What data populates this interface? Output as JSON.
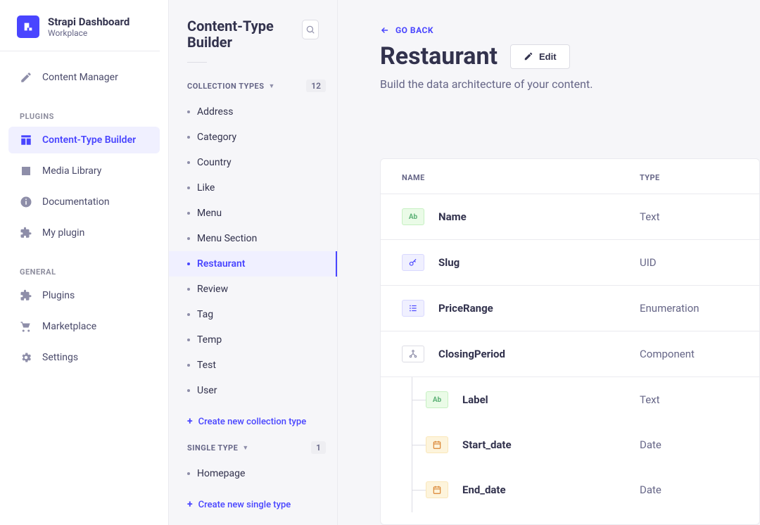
{
  "sidebar": {
    "product": "Strapi Dashboard",
    "workspace": "Workplace",
    "content_manager": "Content Manager",
    "sections": {
      "plugins_label": "PLUGINS",
      "plugins_items": [
        {
          "label": "Content-Type Builder",
          "icon": "layout"
        },
        {
          "label": "Media Library",
          "icon": "image"
        },
        {
          "label": "Documentation",
          "icon": "info"
        },
        {
          "label": "My plugin",
          "icon": "puzzle"
        }
      ],
      "general_label": "GENERAL",
      "general_items": [
        {
          "label": "Plugins",
          "icon": "puzzle"
        },
        {
          "label": "Marketplace",
          "icon": "cart"
        },
        {
          "label": "Settings",
          "icon": "gear"
        }
      ]
    }
  },
  "sub": {
    "title": "Content-Type Builder",
    "collection_label": "COLLECTION TYPES",
    "collection_count": "12",
    "collection_types": [
      "Address",
      "Category",
      "Country",
      "Like",
      "Menu",
      "Menu Section",
      "Restaurant",
      "Review",
      "Tag",
      "Temp",
      "Test",
      "User"
    ],
    "collection_active": "Restaurant",
    "create_collection": "Create new collection type",
    "single_label": "SINGLE TYPE",
    "single_count": "1",
    "single_types": [
      "Homepage"
    ],
    "create_single": "Create new single type"
  },
  "main": {
    "go_back": "GO BACK",
    "title": "Restaurant",
    "edit_label": "Edit",
    "subtitle": "Build the data architecture of your content.",
    "columns": {
      "name": "NAME",
      "type": "TYPE"
    },
    "fields": [
      {
        "icon": "text",
        "label": "Ab",
        "name": "Name",
        "type": "Text"
      },
      {
        "icon": "uid",
        "label": "🔑",
        "name": "Slug",
        "type": "UID"
      },
      {
        "icon": "enum",
        "label": "≣",
        "name": "PriceRange",
        "type": "Enumeration"
      },
      {
        "icon": "comp",
        "label": "⋔",
        "name": "ClosingPeriod",
        "type": "Component",
        "children": [
          {
            "icon": "text",
            "label": "Ab",
            "name": "Label",
            "type": "Text"
          },
          {
            "icon": "date",
            "label": "📅",
            "name": "Start_date",
            "type": "Date"
          },
          {
            "icon": "date",
            "label": "📅",
            "name": "End_date",
            "type": "Date"
          }
        ]
      }
    ]
  }
}
